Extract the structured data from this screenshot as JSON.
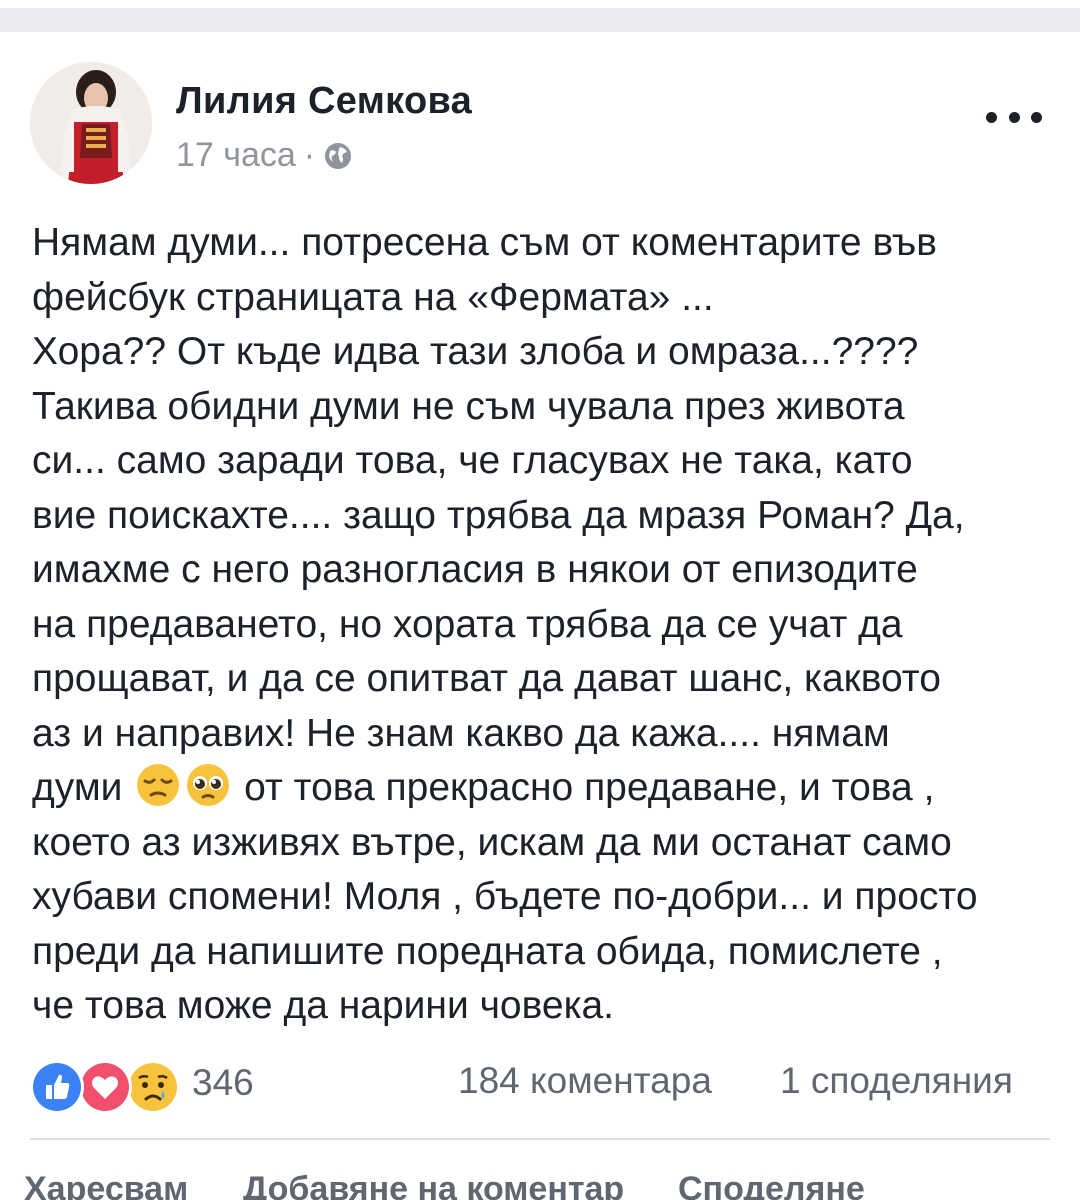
{
  "post": {
    "author": "Лилия Семкова",
    "time": "17 часа",
    "separator": "·",
    "privacy_icon": "globe-icon",
    "menu_icon": "more-options-icon",
    "lines": [
      [
        "Нямам думи... потресена съм от коментарите във"
      ],
      [
        "фейсбук страницата на «Фермата» ..."
      ],
      [
        "Хора?? От къде идва тази злоба и омраза...????"
      ],
      [
        "Такива обидни думи не съм чувала през живота"
      ],
      [
        "си... само заради това, че гласувах не така, като"
      ],
      [
        "вие поискахте.... защо трябва да мразя Роман? Да,"
      ],
      [
        "имахме с него разногласия в някои от епизодите"
      ],
      [
        "на предаването, но хората трябва да се учат да"
      ],
      [
        "прощават, и да се опитват да дават шанс, каквото"
      ],
      [
        "аз и направих! Не знам какво да кажа.... нямам"
      ],
      [
        "думи",
        "от това прекрасно предаване, и това ,"
      ],
      [
        " което аз изживях вътре, искам да ми останат само"
      ],
      [
        "хубави спомени! Моля , бъдете по-добри... и просто"
      ],
      [
        "преди да напишите поредната обида, помислете ,"
      ],
      [
        " че това може да нарини човека."
      ]
    ],
    "emojis": [
      "pensive-face-emoji",
      "pleading-face-emoji"
    ]
  },
  "stats": {
    "reaction_icons": [
      "like-reaction-icon",
      "love-reaction-icon",
      "sad-reaction-icon"
    ],
    "reactions_count": "346",
    "comments": "184 коментара",
    "shares": "1 споделяния"
  },
  "actions": {
    "like": "Харесвам",
    "comment": "Добавяне на коментар",
    "share": "Споделяне"
  },
  "colors": {
    "like_blue": "#3b82f6",
    "love_red": "#f0506e",
    "sad_yellow": "#f7c33c",
    "text": "#1d2129",
    "muted": "#90949c"
  }
}
